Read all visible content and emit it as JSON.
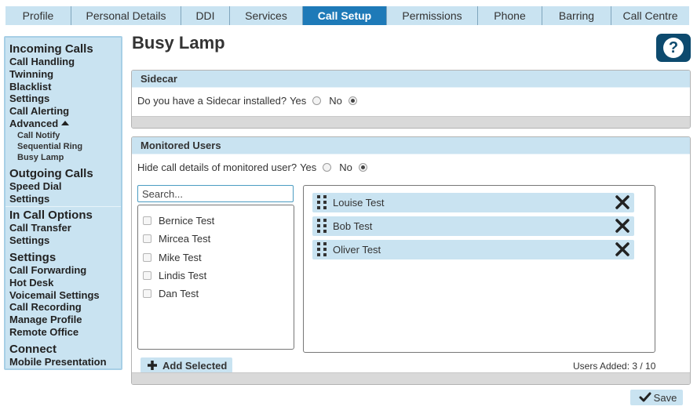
{
  "tabs": [
    {
      "label": "Profile",
      "active": false
    },
    {
      "label": "Personal Details",
      "active": false
    },
    {
      "label": "DDI",
      "active": false
    },
    {
      "label": "Services",
      "active": false
    },
    {
      "label": "Call Setup",
      "active": true
    },
    {
      "label": "Permissions",
      "active": false
    },
    {
      "label": "Phone",
      "active": false
    },
    {
      "label": "Barring",
      "active": false
    },
    {
      "label": "Call Centre",
      "active": false
    }
  ],
  "sidebar": {
    "incoming": {
      "title": "Incoming Calls",
      "items": [
        "Call Handling",
        "Twinning",
        "Blacklist",
        "Settings",
        "Call Alerting"
      ],
      "advanced": "Advanced",
      "advanced_items": [
        "Call Notify",
        "Sequential Ring",
        "Busy Lamp"
      ]
    },
    "outgoing": {
      "title": "Outgoing Calls",
      "items": [
        "Speed Dial",
        "Settings"
      ]
    },
    "in_call": {
      "title": "In Call Options",
      "items": [
        "Call Transfer",
        "Settings"
      ]
    },
    "settings": {
      "title": "Settings",
      "items": [
        "Call Forwarding",
        "Hot Desk",
        "Voicemail Settings",
        "Call Recording",
        "Manage Profile",
        "Remote Office"
      ]
    },
    "connect": {
      "title": "Connect",
      "items": [
        "Mobile Presentation"
      ]
    }
  },
  "page": {
    "title": "Busy Lamp",
    "help_symbol": "?"
  },
  "sidecar": {
    "header": "Sidecar",
    "question": "Do you have a Sidecar installed?",
    "yes": "Yes",
    "no": "No",
    "selected": "No"
  },
  "monitored": {
    "header": "Monitored Users",
    "question": "Hide call details of monitored user?",
    "yes": "Yes",
    "no": "No",
    "selected": "No",
    "search_placeholder": "Search...",
    "available": [
      "Bernice Test",
      "Mircea Test",
      "Mike Test",
      "Lindis Test",
      "Dan Test"
    ],
    "added": [
      "Louise Test",
      "Bob Test",
      "Oliver Test"
    ],
    "add_selected": "Add Selected",
    "users_added": "Users Added: 3 / 10"
  },
  "save_label": "Save",
  "colors": {
    "accent": "#1e7ab8",
    "tab_bg": "#c9e3f1",
    "help_bg": "#0d4a6e"
  }
}
